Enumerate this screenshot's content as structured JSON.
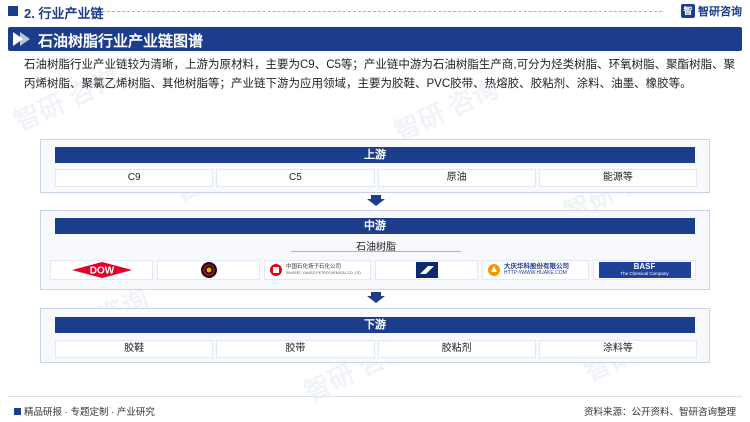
{
  "header": {
    "section_title": "2. 行业产业链",
    "brand_name": "智研咨询",
    "brand_mark": "智"
  },
  "title": "石油树脂行业产业链图谱",
  "description": "石油树脂行业产业链较为清晰，上游为原材料，主要为C9、C5等；产业链中游为石油树脂生产商,可分为烃类树脂、环氧树脂、聚酯树脂、聚丙烯树脂、聚氯乙烯树脂、其他树脂等；产业链下游为应用领域，主要为胶鞋、PVC胶带、热熔胶、胶粘剂、涂料、油墨、橡胶等。",
  "chain": {
    "upstream": {
      "label": "上游",
      "items": [
        "C9",
        "C5",
        "原油",
        "能源等"
      ]
    },
    "midstream": {
      "label": "中游",
      "sublabel": "石油树脂",
      "logos": [
        {
          "name": "DOW",
          "icon": "dow-logo"
        },
        {
          "name": "",
          "icon": "circle-logo"
        },
        {
          "name": "中国石化扬子石化公司",
          "sub": "SINOPEC YANGZI PETROCHEMICAL CO.,LTD",
          "icon": "sinopec-logo"
        },
        {
          "name": "",
          "icon": "arrow-logo"
        },
        {
          "name": "大庆华科股份有限公司",
          "sub": "HTTP://WWW.HUAKE.COM",
          "icon": "huake-logo"
        },
        {
          "name": "BASF",
          "sub": "The Chemical Company",
          "icon": "basf-logo"
        }
      ]
    },
    "downstream": {
      "label": "下游",
      "items": [
        "胶鞋",
        "胶带",
        "胶粘剂",
        "涂料等"
      ]
    }
  },
  "footer": {
    "left": "精品研报 · 专题定制 · 产业研究",
    "right": "资料来源：公开资料、智研咨询整理"
  },
  "colors": {
    "accent": "#1c3d8c",
    "dow_red": "#e4002b",
    "basf_blue": "#21409a",
    "huake_orange": "#f39800"
  }
}
